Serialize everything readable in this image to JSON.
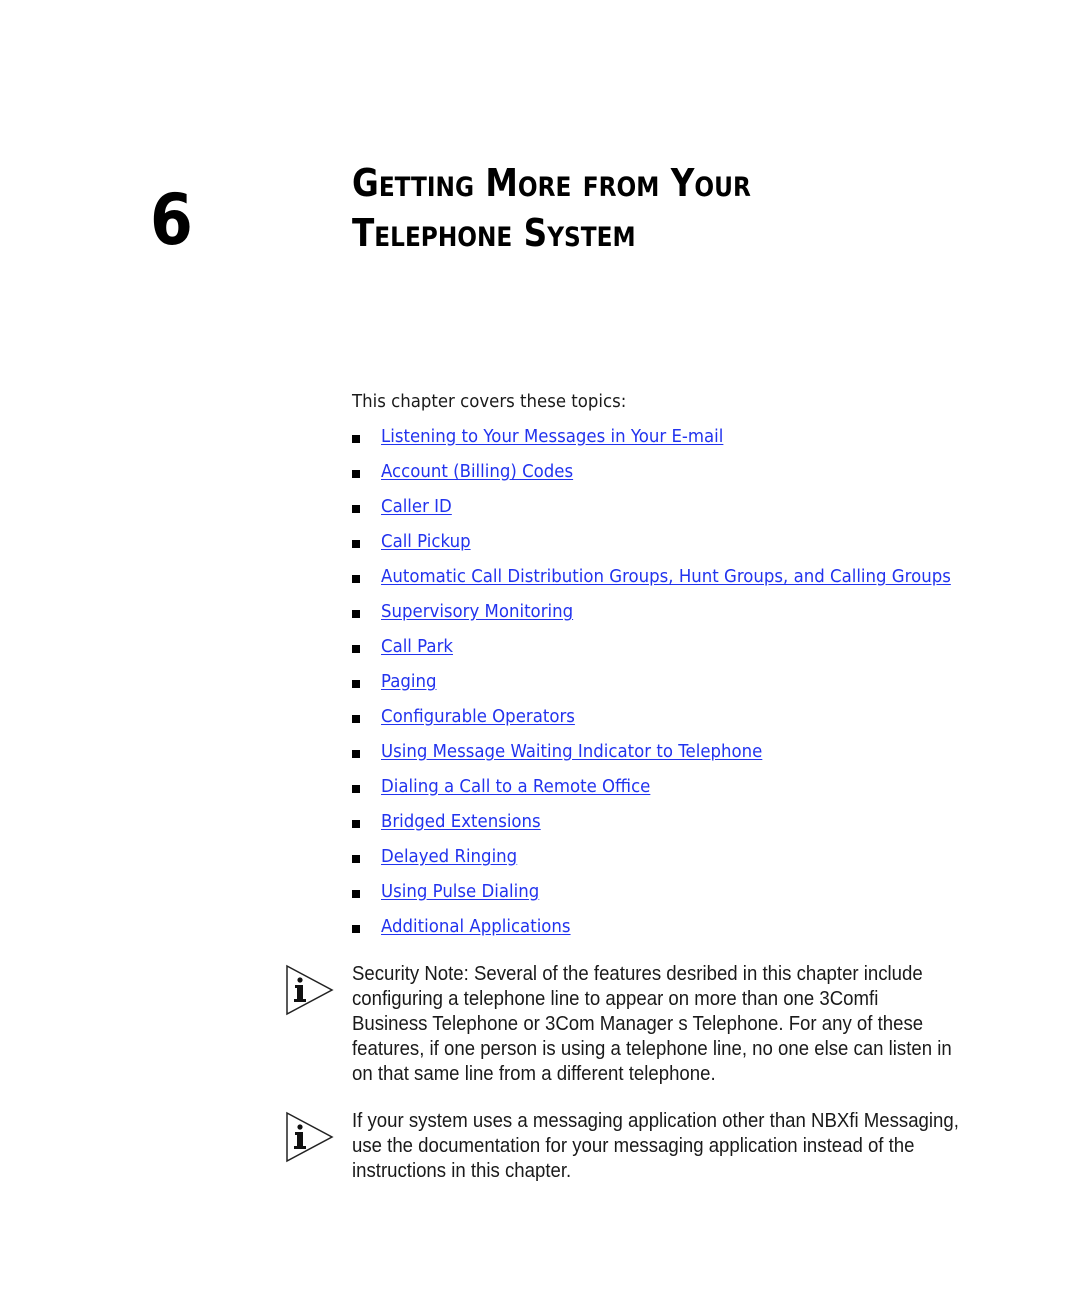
{
  "chapter": {
    "number": "6",
    "title_line1": "Getting More from Your",
    "title_line2": "Telephone System"
  },
  "intro": "This chapter covers these topics:",
  "link_color": "#2233ee",
  "topics": [
    {
      "label": "Listening to Your Messages in Your E-mail"
    },
    {
      "label": "Account (Billing) Codes"
    },
    {
      "label": "Caller ID"
    },
    {
      "label": "Call Pickup"
    },
    {
      "label": "Automatic Call Distribution Groups, Hunt Groups, and Calling Groups"
    },
    {
      "label": "Supervisory Monitoring"
    },
    {
      "label": "Call Park"
    },
    {
      "label": "Paging"
    },
    {
      "label": "Configurable Operators"
    },
    {
      "label": "Using Message Waiting Indicator to Telephone"
    },
    {
      "label": "Dialing a Call to a Remote Office"
    },
    {
      "label": "Bridged Extensions"
    },
    {
      "label": "Delayed Ringing"
    },
    {
      "label": "Using Pulse Dialing"
    },
    {
      "label": "Additional Applications"
    }
  ],
  "notes": [
    {
      "icon": "info-icon",
      "text": "Security Note:  Several of the features desribed in this chapter include\nconfiguring a telephone line to appear on more than one 3Comfi\nBusiness Telephone or 3Com Manager s Telephone. For any of these\nfeatures, if one person is using a telephone line, no one else can listen in\non that same line from a different telephone."
    },
    {
      "icon": "info-icon",
      "text": "If your system uses a messaging application other than NBXfi Messaging,\nuse the documentation for your messaging application instead of the\ninstructions in this chapter."
    }
  ]
}
